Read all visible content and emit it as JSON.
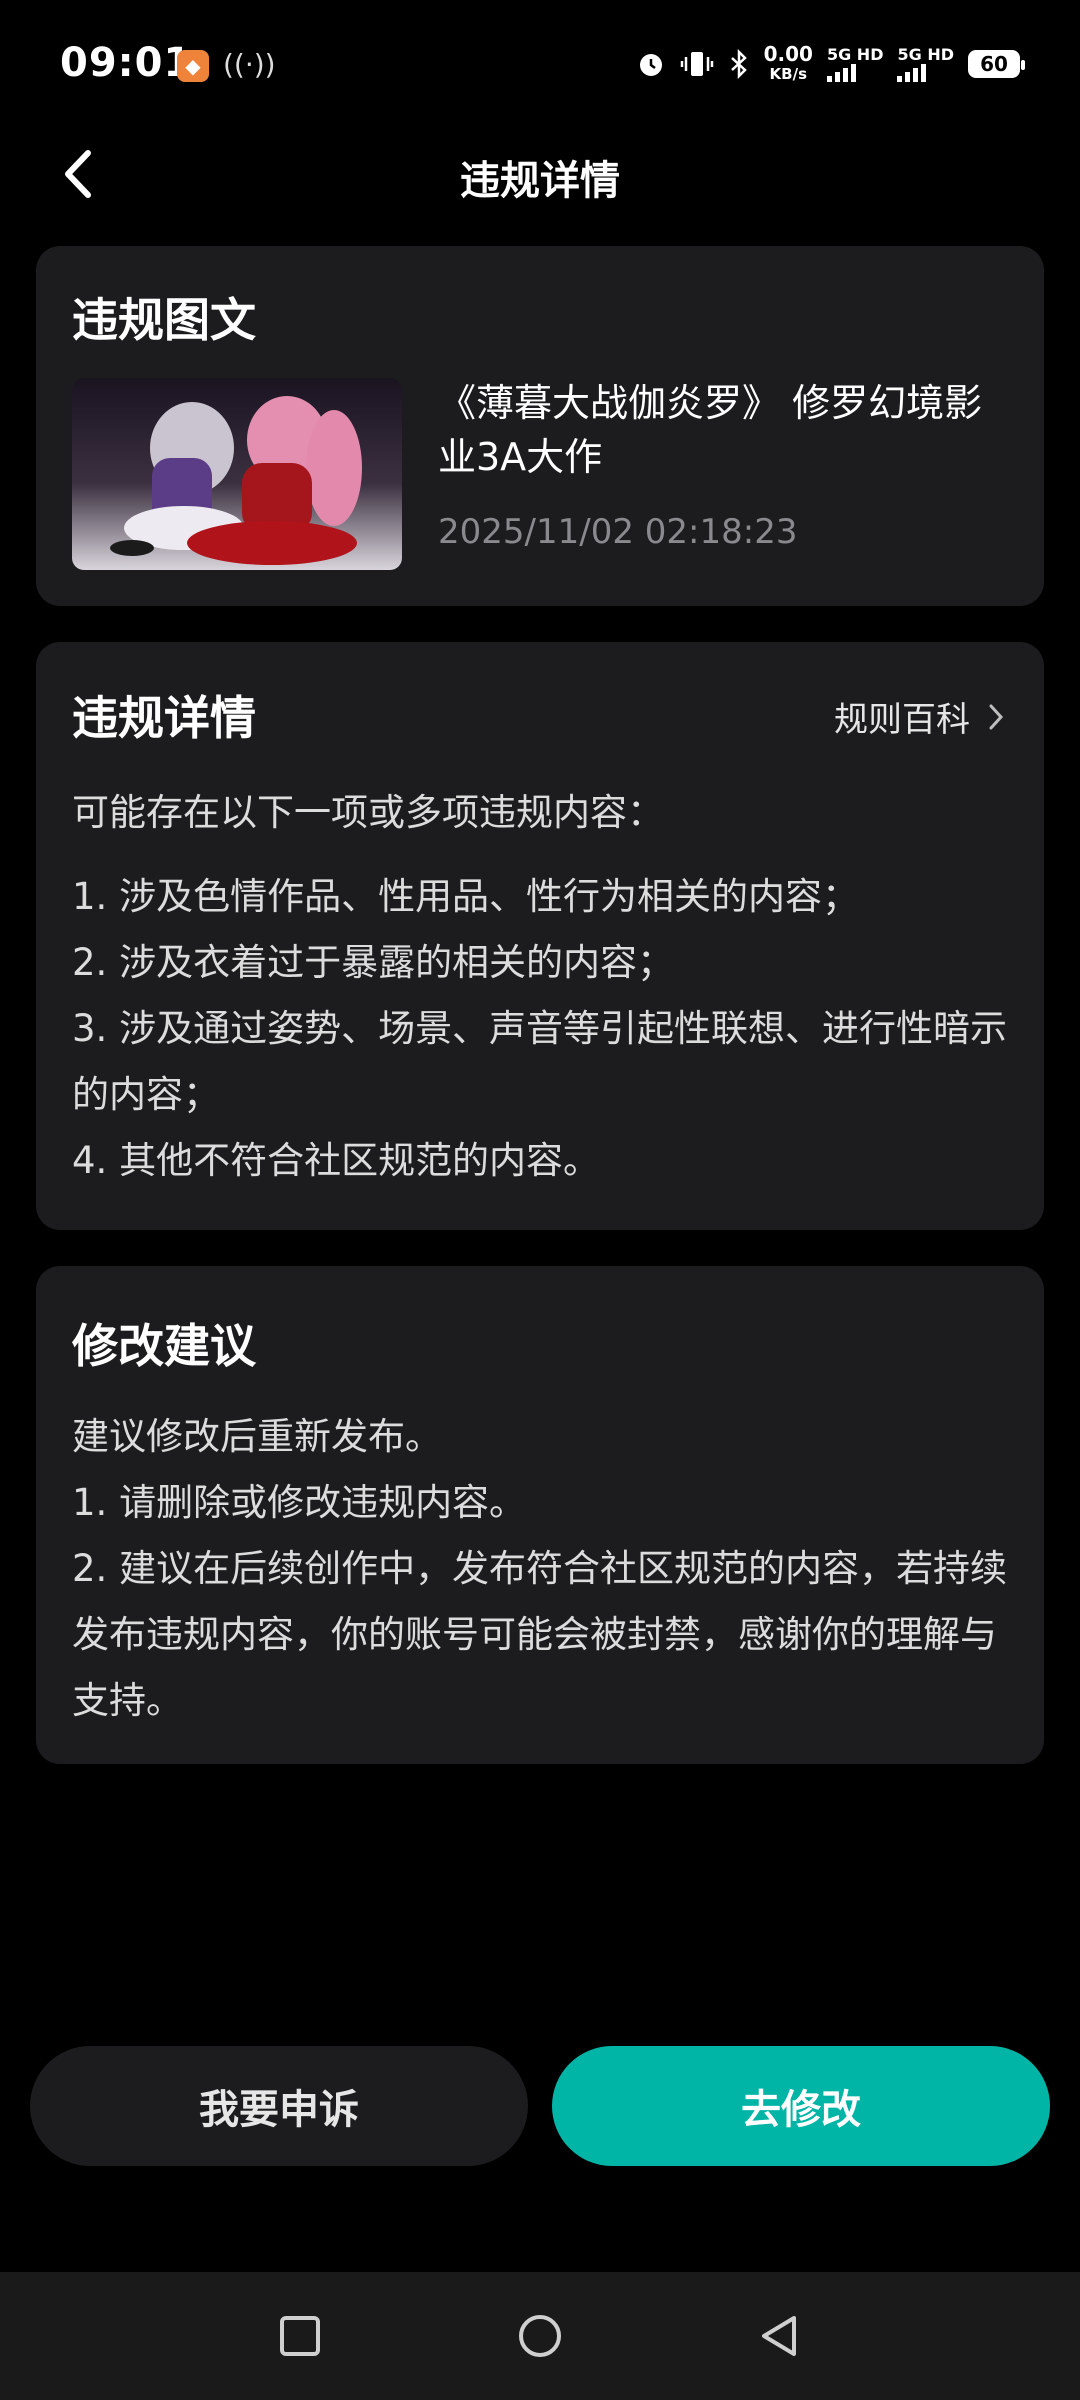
{
  "status_bar": {
    "time": "09:01",
    "speed_value": "0.00",
    "speed_unit": "KB/s",
    "sim1": "5G HD",
    "sim2": "5G HD",
    "battery": "60"
  },
  "header": {
    "title": "违规详情"
  },
  "post_card": {
    "title": "违规图文",
    "post_title": "《薄暮大战伽炎罗》 修罗幻境影业3A大作",
    "post_time": "2025/11/02 02:18:23"
  },
  "details_card": {
    "title": "违规详情",
    "rules_link": "规则百科",
    "intro": "可能存在以下一项或多项违规内容：",
    "items": [
      "1. 涉及色情作品、性用品、性行为相关的内容；",
      "2. 涉及衣着过于暴露的相关的内容；",
      "3. 涉及通过姿势、场景、声音等引起性联想、进行性暗示的内容；",
      "4. 其他不符合社区规范的内容。"
    ]
  },
  "advice_card": {
    "title": "修改建议",
    "lines": [
      "建议修改后重新发布。",
      "1. 请删除或修改违规内容。",
      "2. 建议在后续创作中，发布符合社区规范的内容，若持续发布违规内容，你的账号可能会被封禁，感谢你的理解与支持。"
    ]
  },
  "actions": {
    "appeal": "我要申诉",
    "modify": "去修改"
  },
  "colors": {
    "accent": "#00b5a6",
    "card_bg": "#1c1c1e",
    "page_bg": "#000000"
  }
}
